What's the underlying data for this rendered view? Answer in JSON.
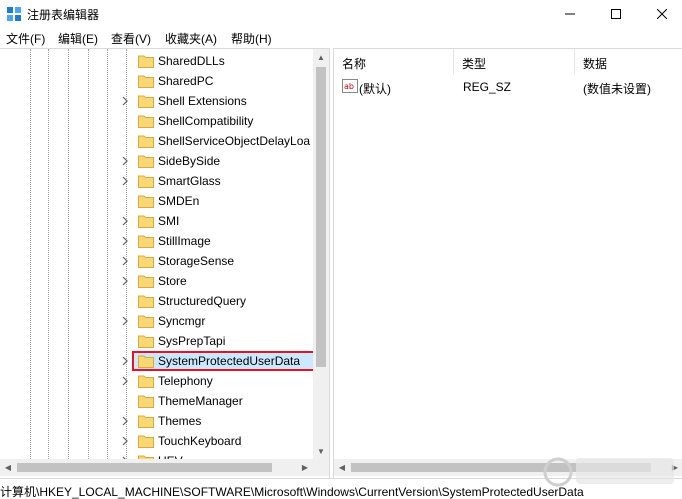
{
  "window": {
    "title": "注册表编辑器"
  },
  "menu": [
    "文件(F)",
    "编辑(E)",
    "查看(V)",
    "收藏夹(A)",
    "帮助(H)"
  ],
  "tree": {
    "items": [
      {
        "label": "SharedDLLs",
        "expandable": false
      },
      {
        "label": "SharedPC",
        "expandable": false
      },
      {
        "label": "Shell Extensions",
        "expandable": true
      },
      {
        "label": "ShellCompatibility",
        "expandable": false
      },
      {
        "label": "ShellServiceObjectDelayLoa",
        "expandable": false
      },
      {
        "label": "SideBySide",
        "expandable": true
      },
      {
        "label": "SmartGlass",
        "expandable": true
      },
      {
        "label": "SMDEn",
        "expandable": false
      },
      {
        "label": "SMI",
        "expandable": true
      },
      {
        "label": "StillImage",
        "expandable": true
      },
      {
        "label": "StorageSense",
        "expandable": true
      },
      {
        "label": "Store",
        "expandable": true
      },
      {
        "label": "StructuredQuery",
        "expandable": false
      },
      {
        "label": "Syncmgr",
        "expandable": true
      },
      {
        "label": "SysPrepTapi",
        "expandable": false
      },
      {
        "label": "SystemProtectedUserData",
        "expandable": true,
        "selected": true
      },
      {
        "label": "Telephony",
        "expandable": true
      },
      {
        "label": "ThemeManager",
        "expandable": false
      },
      {
        "label": "Themes",
        "expandable": true
      },
      {
        "label": "TouchKeyboard",
        "expandable": true
      },
      {
        "label": "UEV",
        "expandable": true
      }
    ]
  },
  "values": {
    "columns": {
      "name": "名称",
      "type": "类型",
      "data": "数据"
    },
    "rows": [
      {
        "name": "(默认)",
        "type": "REG_SZ",
        "data": "(数值未设置)",
        "icon": "string-value-icon"
      }
    ]
  },
  "status": {
    "path": "计算机\\HKEY_LOCAL_MACHINE\\SOFTWARE\\Microsoft\\Windows\\CurrentVersion\\SystemProtectedUserData"
  },
  "colors": {
    "selection_border": "#e81123",
    "selection_fill": "#cce8ff",
    "folder": "#f8d775"
  }
}
